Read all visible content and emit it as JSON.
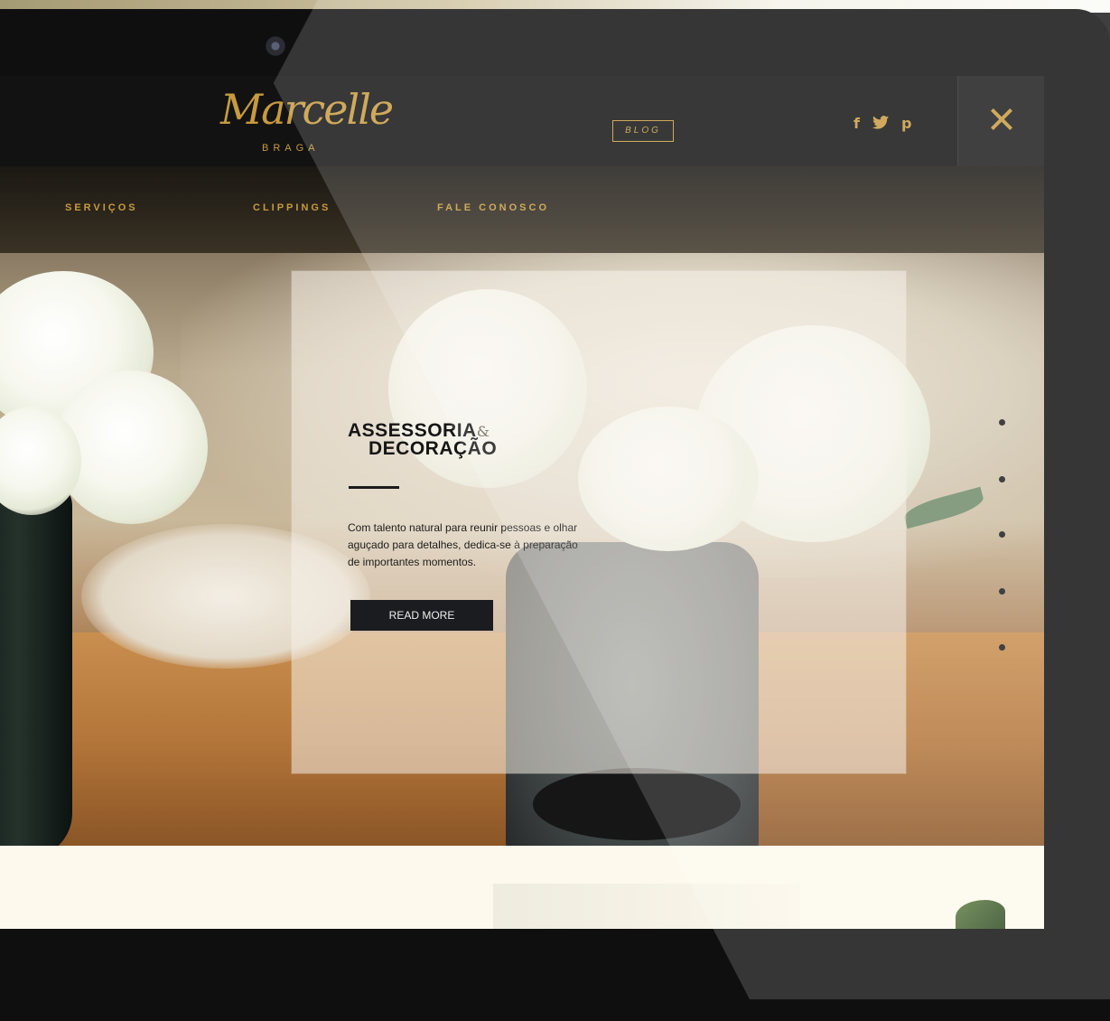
{
  "brand": {
    "logo_script": "Marcelle",
    "logo_sub": "BRAGA"
  },
  "social": {
    "facebook": "f",
    "twitter": "🐦",
    "pinterest": "p"
  },
  "nav": {
    "items": [
      "SERVIÇOS",
      "CLIPPINGS",
      "FALE CONOSCO"
    ],
    "blog": "BLOG"
  },
  "hero_card": {
    "title_line1": "ASSESSORIA",
    "title_amp": "&",
    "title_line2": "DECORAÇÃO",
    "body": "Com talento natural para reunir pessoas e olhar aguçado para detalhes, dedica-se à preparação de importantes momentos.",
    "button": "READ MORE"
  },
  "slider": {
    "dot_count": 5
  },
  "colors": {
    "accent_gold": "#c69a3e",
    "header_bg": "#121212",
    "cream": "#fdf9ec",
    "button_dark": "#1a1c1f"
  },
  "icons": {
    "close": "close-icon",
    "facebook": "facebook-icon",
    "twitter": "twitter-icon",
    "pinterest": "pinterest-icon",
    "camera": "webcam-icon"
  }
}
